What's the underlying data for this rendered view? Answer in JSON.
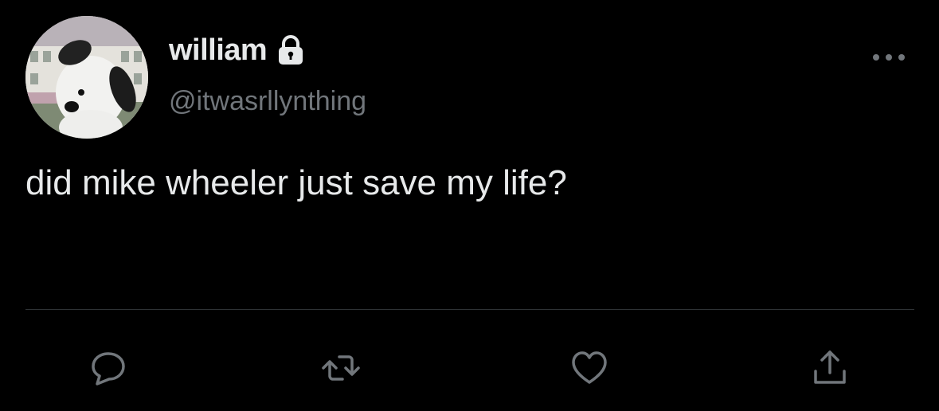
{
  "user": {
    "display_name": "william",
    "handle": "@itwasrllynthing",
    "protected": true
  },
  "tweet": {
    "text": "did mike wheeler just save my life?"
  },
  "actions": {
    "items": [
      "reply-icon",
      "retweet-icon",
      "like-icon",
      "share-icon"
    ]
  },
  "colors": {
    "background": "#000000",
    "primary_text": "#e7e9ea",
    "secondary_text": "#71767b",
    "divider": "#2f3336"
  }
}
